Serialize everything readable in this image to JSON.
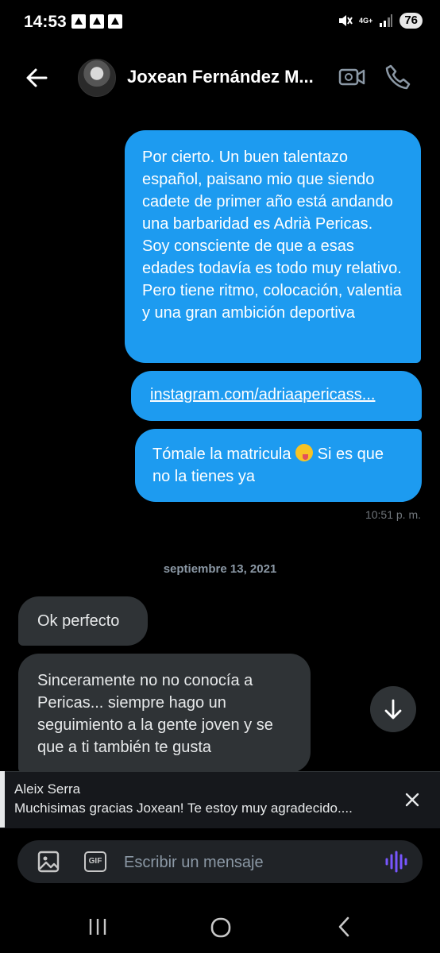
{
  "status_bar": {
    "time": "14:53",
    "network": "4G+",
    "battery": "76"
  },
  "header": {
    "contact_name": "Joxean Fernández M..."
  },
  "messages": [
    {
      "text": "Por cierto. Un buen talentazo español, paisano mio que siendo cadete de primer año está andando una barbaridad es Adrià Pericas.  Soy consciente de que a esas edades todavía es todo muy relativo. Pero tiene ritmo, colocación, valentia y una gran ambición deportiva"
    },
    {
      "text": "instagram.com/adriaapericass..."
    },
    {
      "text_before": "Tómale la matricula ",
      "text_after": " Si es que no la tienes ya",
      "time": "10:51 p. m."
    },
    {
      "text": "Ok perfecto"
    },
    {
      "text": "Sinceramente no no conocía a Pericas... siempre hago un seguimiento a la gente joven y se que a ti también te gusta"
    }
  ],
  "date_separator": "septiembre 13, 2021",
  "reply_preview": {
    "name": "Aleix Serra",
    "text": "Muchisimas gracias Joxean! Te estoy muy agradecido...."
  },
  "composer": {
    "placeholder": "Escribir un mensaje",
    "gif_label": "GIF"
  },
  "colors": {
    "outgoing_bubble": "#1d9bf0",
    "incoming_bubble": "#2f3336",
    "background": "#000000",
    "voice_icon": "#7856ff"
  }
}
